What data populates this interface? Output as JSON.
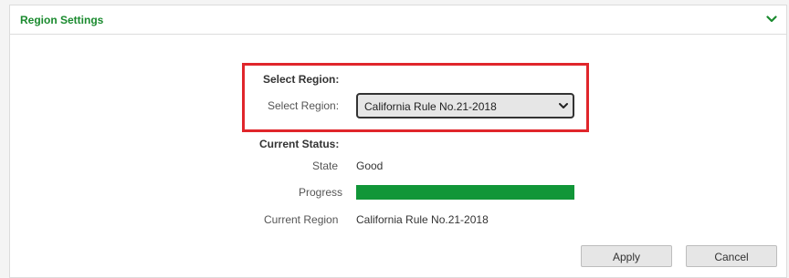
{
  "panel": {
    "title": "Region Settings",
    "collapse_icon": "chevron-down-icon",
    "accent_color": "#1a8a2e"
  },
  "select_region": {
    "section_label": "Select Region:",
    "field_label": "Select Region:",
    "selected_value": "California Rule No.21-2018",
    "highlight_color": "#e0262b"
  },
  "current_status": {
    "section_label": "Current Status:",
    "state_label": "State",
    "state_value": "Good",
    "progress_label": "Progress",
    "progress_percent": 100,
    "progress_color": "#119638",
    "region_label": "Current Region",
    "region_value": "California Rule No.21-2018"
  },
  "buttons": {
    "apply": "Apply",
    "cancel": "Cancel"
  }
}
